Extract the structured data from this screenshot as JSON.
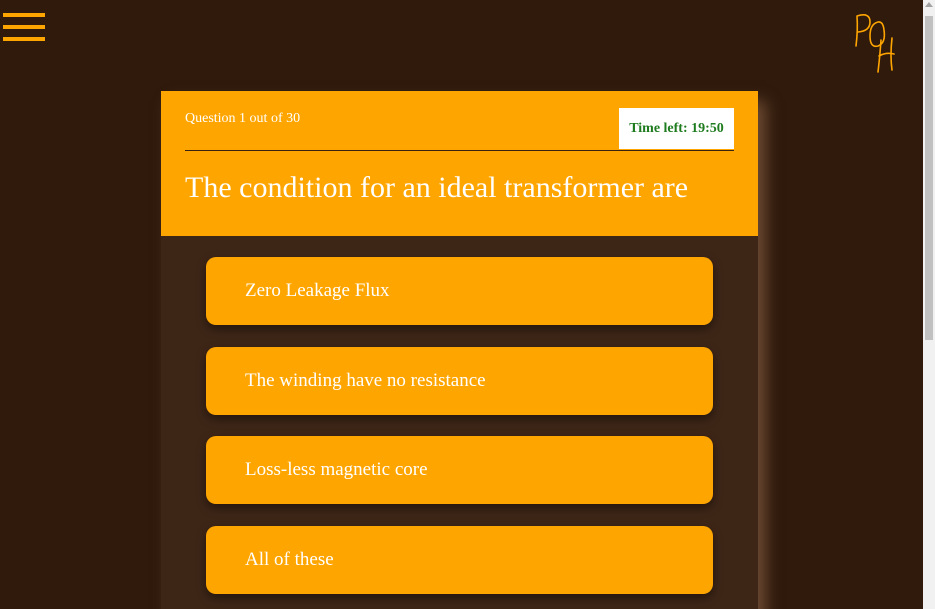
{
  "colors": {
    "background": "#2f1a0c",
    "accent": "#ffa500",
    "card": "#3e2617",
    "timer_text": "#1e7b1e"
  },
  "header": {
    "menu_icon": "hamburger-menu-icon",
    "logo_text": "POH"
  },
  "quiz": {
    "progress_label": "Question 1 out of 30",
    "timer_label": "Time left: 19:50",
    "question": "The condition for an ideal transformer are",
    "options": [
      {
        "label": "Zero Leakage Flux"
      },
      {
        "label": "The winding have no resistance"
      },
      {
        "label": "Loss-less magnetic core"
      },
      {
        "label": "All of these"
      }
    ]
  }
}
